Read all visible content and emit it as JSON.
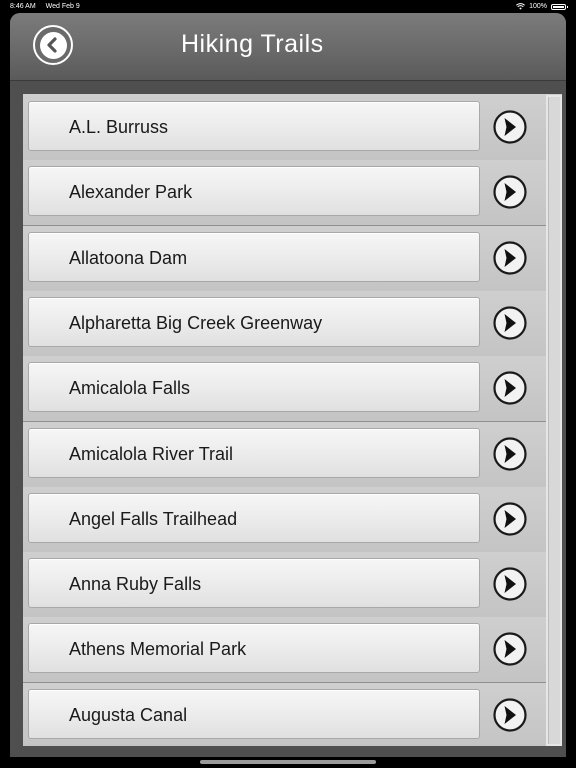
{
  "status_bar": {
    "time": "8:46 AM",
    "date": "Wed Feb 9",
    "battery": "100%"
  },
  "header": {
    "title": "Hiking Trails"
  },
  "trails": [
    {
      "label": "A.L. Burruss"
    },
    {
      "label": "Alexander Park"
    },
    {
      "label": "Allatoona Dam"
    },
    {
      "label": "Alpharetta Big Creek Greenway"
    },
    {
      "label": "Amicalola Falls"
    },
    {
      "label": "Amicalola River Trail"
    },
    {
      "label": "Angel Falls Trailhead"
    },
    {
      "label": "Anna Ruby Falls"
    },
    {
      "label": "Athens Memorial Park"
    },
    {
      "label": "Augusta Canal"
    }
  ],
  "icons": {
    "back": "back-arrow-icon",
    "row": "chevron-right-icon"
  }
}
